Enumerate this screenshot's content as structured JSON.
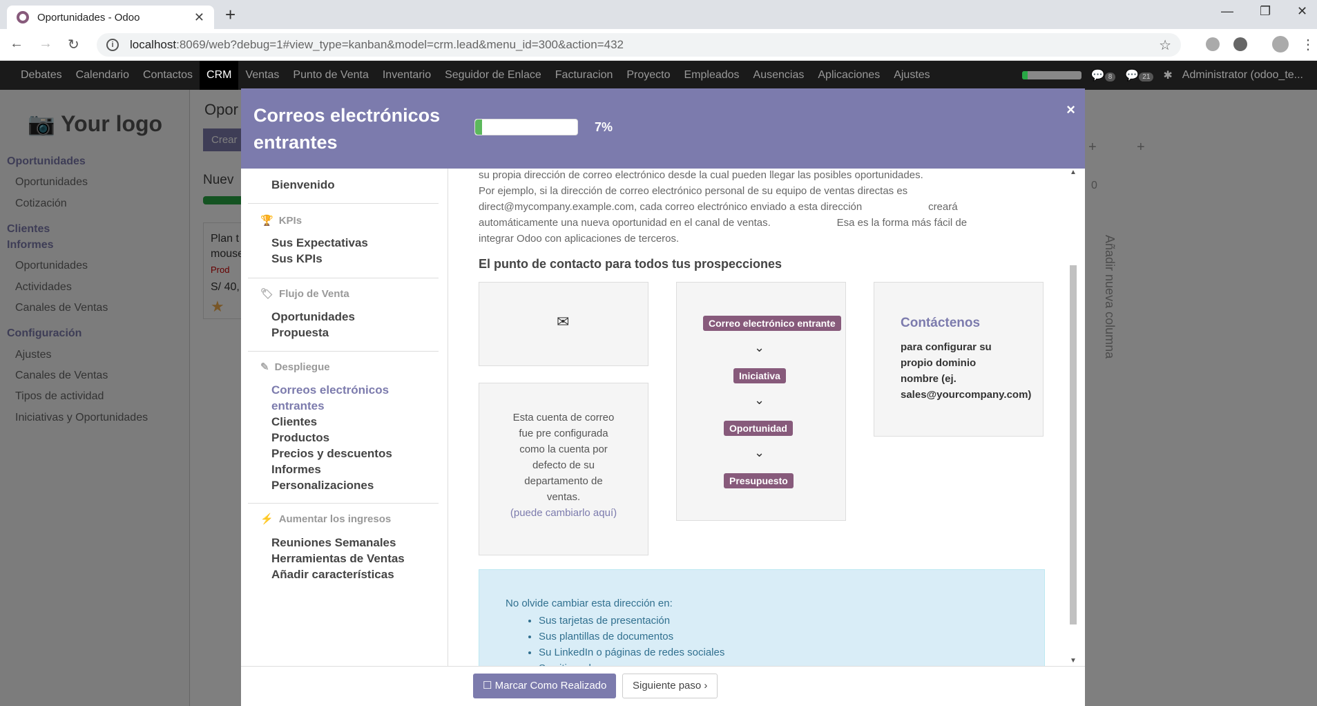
{
  "browser": {
    "tab_title": "Oportunidades - Odoo",
    "url_host": "localhost",
    "url_rest": ":8069/web?debug=1#view_type=kanban&model=crm.lead&menu_id=300&action=432"
  },
  "odoo_nav": {
    "items": [
      "Debates",
      "Calendario",
      "Contactos",
      "CRM",
      "Ventas",
      "Punto de Venta",
      "Inventario",
      "Seguidor de Enlace",
      "Facturacion",
      "Proyecto",
      "Empleados",
      "Ausencias",
      "Aplicaciones",
      "Ajustes"
    ],
    "active": "CRM",
    "badge_1": "8",
    "badge_2": "21",
    "user": "Administrator (odoo_te..."
  },
  "sidebar": {
    "logo": "Your logo",
    "sections": [
      {
        "header": "Oportunidades",
        "items": [
          "Oportunidades",
          "Cotización"
        ]
      },
      {
        "header": "Clientes",
        "items": []
      },
      {
        "header": "Informes",
        "items": [
          "Oportunidades",
          "Actividades",
          "Canales de Ventas"
        ]
      },
      {
        "header": "Configuración",
        "items": [
          "Ajustes",
          "Canales de Ventas",
          "Tipos de actividad",
          "Iniciativas y Oportunidades"
        ]
      }
    ]
  },
  "modal": {
    "title_line1": "Correos electrónicos",
    "title_line2": "entrantes",
    "progress": 7,
    "progress_label": "7%",
    "close": "×",
    "left_nav": {
      "welcome": "Bienvenido",
      "sec1": "KPIs",
      "sec1_items": [
        "Sus Expectativas",
        "Sus KPIs"
      ],
      "sec2": "Flujo de Venta",
      "sec2_items": [
        "Oportunidades",
        "Propuesta"
      ],
      "sec3": "Despliegue",
      "sec3_items": [
        "Correos electrónicos",
        "entrantes",
        "Clientes",
        "Productos",
        "Precios y descuentos",
        "Informes",
        "Personalizaciones"
      ],
      "sec4": "Aumentar los ingresos",
      "sec4_items": [
        "Reuniones Semanales",
        "Herramientas de Ventas",
        "Añadir características"
      ]
    },
    "content": {
      "para_lines": [
        "su propia dirección de correo electrónico desde la cual pueden llegar las posibles oportunidades.",
        "Por ejemplo, si la dirección de correo electrónico personal de su equipo de ventas directas es",
        "direct@mycompany.example.com, cada correo electrónico enviado a esta dirección                       creará",
        "automáticamente una nueva oportunidad en el canal de ventas.                       Esa es la forma más fácil de",
        "integrar Odoo con aplicaciones de terceros."
      ],
      "heading": "El punto de contacto para todos tus prospecciones",
      "account_text": [
        "Esta cuenta de correo",
        "fue pre configurada",
        "como la cuenta por",
        "defecto de su",
        "departamento de",
        "ventas."
      ],
      "account_link": "(puede cambiarlo aquí)",
      "flow_tags": [
        "Correo electrónico entrante",
        "Iniciativa",
        "Oportunidad",
        "Presupuesto"
      ],
      "contact_title": "Contáctenos",
      "contact_lines": [
        "para configurar su",
        "propio dominio",
        "nombre (ej.",
        "sales@yourcompany.com)"
      ],
      "note_title": "No olvide cambiar esta dirección en:",
      "note_items": [
        "Sus tarjetas de presentación",
        "Sus plantillas de documentos",
        "Su LinkedIn o páginas de redes sociales",
        "Su sitio web"
      ]
    },
    "footer": {
      "done_label": "Marcar Como Realizado",
      "next_label": "Siguiente paso"
    }
  },
  "background": {
    "page_title": "Opor",
    "create": "Crear",
    "col": "Nuev",
    "card_1": "Plan t",
    "card_2": "mouse",
    "card_3": "Prod",
    "card_4": "S/ 40,",
    "add_col": "Añadir nueva columna",
    "zero": "0"
  }
}
